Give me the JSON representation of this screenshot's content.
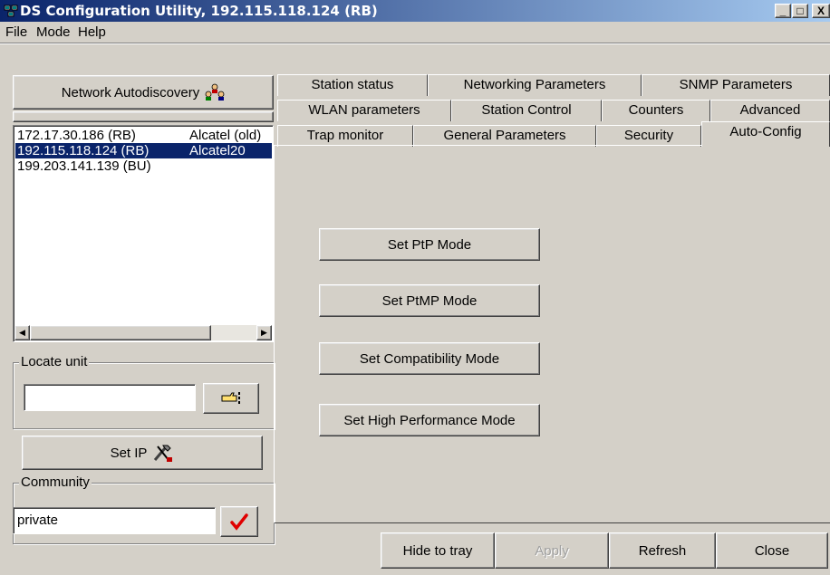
{
  "window": {
    "title": "DS Configuration Utility, 192.115.118.124  (RB)",
    "controls": [
      "_",
      "□",
      "X"
    ]
  },
  "menu": [
    "File",
    "Mode",
    "Help"
  ],
  "left": {
    "autodiscovery_label": "Network Autodiscovery",
    "hosts": [
      {
        "ip": "172.17.30.186  (RB)",
        "model": "Alcatel (old)",
        "selected": false
      },
      {
        "ip": "192.115.118.124  (RB)",
        "model": "Alcatel20",
        "selected": true
      },
      {
        "ip": "199.203.141.139 (BU)",
        "model": "",
        "selected": false
      }
    ],
    "locate_unit_legend": "Locate unit",
    "locate_value": "",
    "set_ip_label": "Set IP",
    "community_legend": "Community",
    "community_value": "private"
  },
  "tabs": {
    "row1": [
      "Station status",
      "Networking Parameters",
      "SNMP Parameters"
    ],
    "row2": [
      "WLAN parameters",
      "Station Control",
      "Counters",
      "Advanced"
    ],
    "row3": [
      "Trap monitor",
      "General Parameters",
      "Security",
      "Auto-Config"
    ],
    "active": "Auto-Config"
  },
  "autoconfig": {
    "ptp": "Set PtP Mode",
    "ptmp": "Set PtMP Mode",
    "compat": "Set Compatibility Mode",
    "highperf": "Set High Performance Mode"
  },
  "footer": {
    "hide": "Hide to tray",
    "apply": "Apply",
    "refresh": "Refresh",
    "close": "Close"
  },
  "colors": {
    "selection": "#0a246a",
    "face": "#d4d0c8",
    "check": "#e00000"
  }
}
